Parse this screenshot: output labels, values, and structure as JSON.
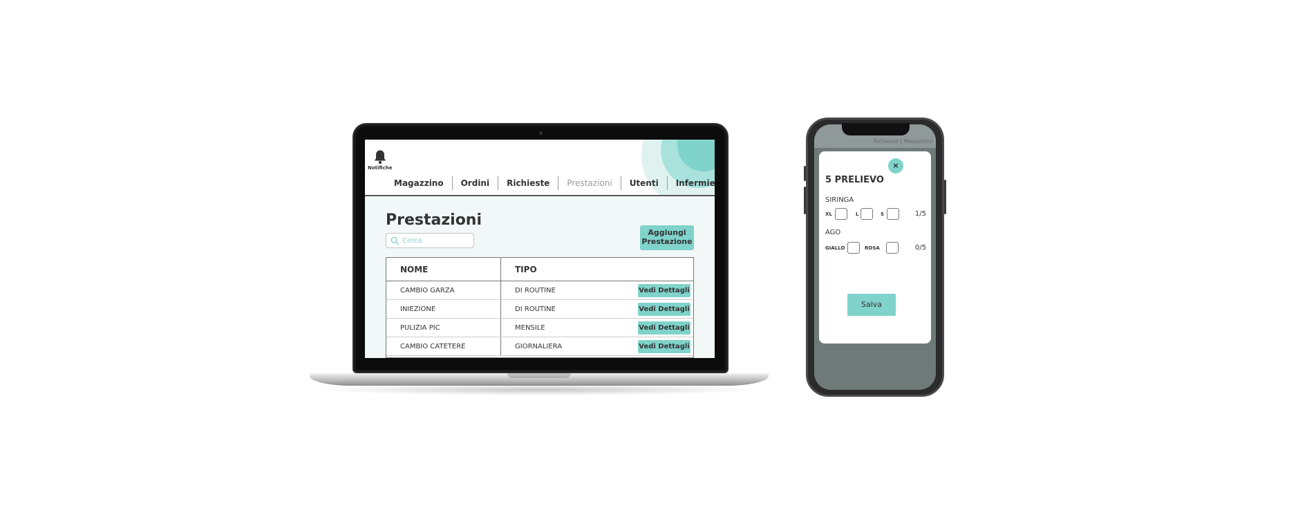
{
  "laptop": {
    "notifications_label": "Notifiche",
    "nav": [
      "Magazzino",
      "Ordini",
      "Richieste",
      "Prestazioni",
      "Utenti",
      "Infermieri"
    ],
    "active_nav": "Prestazioni",
    "page_title": "Prestazioni",
    "search": {
      "placeholder": "Cerca"
    },
    "add_button": {
      "line1": "Aggiungi",
      "line2": "Prestazione"
    },
    "table": {
      "headers": [
        "NOME",
        "TIPO"
      ],
      "rows": [
        {
          "nome": "CAMBIO GARZA",
          "tipo": "DI ROUTINE",
          "action": "Vedi Dettagli"
        },
        {
          "nome": "INIEZIONE",
          "tipo": "DI ROUTINE",
          "action": "Vedi Dettagli"
        },
        {
          "nome": "PULIZIA PIC",
          "tipo": "MENSILE",
          "action": "Vedi Dettagli"
        },
        {
          "nome": "CAMBIO CATETERE",
          "tipo": "GIORNALIERA",
          "action": "Vedi Dettagli"
        }
      ]
    }
  },
  "phone": {
    "nav": "Richieste | Magazzino",
    "modal": {
      "close": "×",
      "title": "5 PRELIEVO",
      "sections": [
        {
          "label": "SIRINGA",
          "options": [
            "XL",
            "L",
            "S"
          ],
          "count": "1/5"
        },
        {
          "label": "AGO",
          "options": [
            "GIALLO",
            "ROSA"
          ],
          "count": "0/5"
        }
      ],
      "save": "Salva"
    }
  },
  "colors": {
    "accent": "#7fd3cb",
    "background_tint": "#f1f8f7",
    "text": "#333333"
  }
}
